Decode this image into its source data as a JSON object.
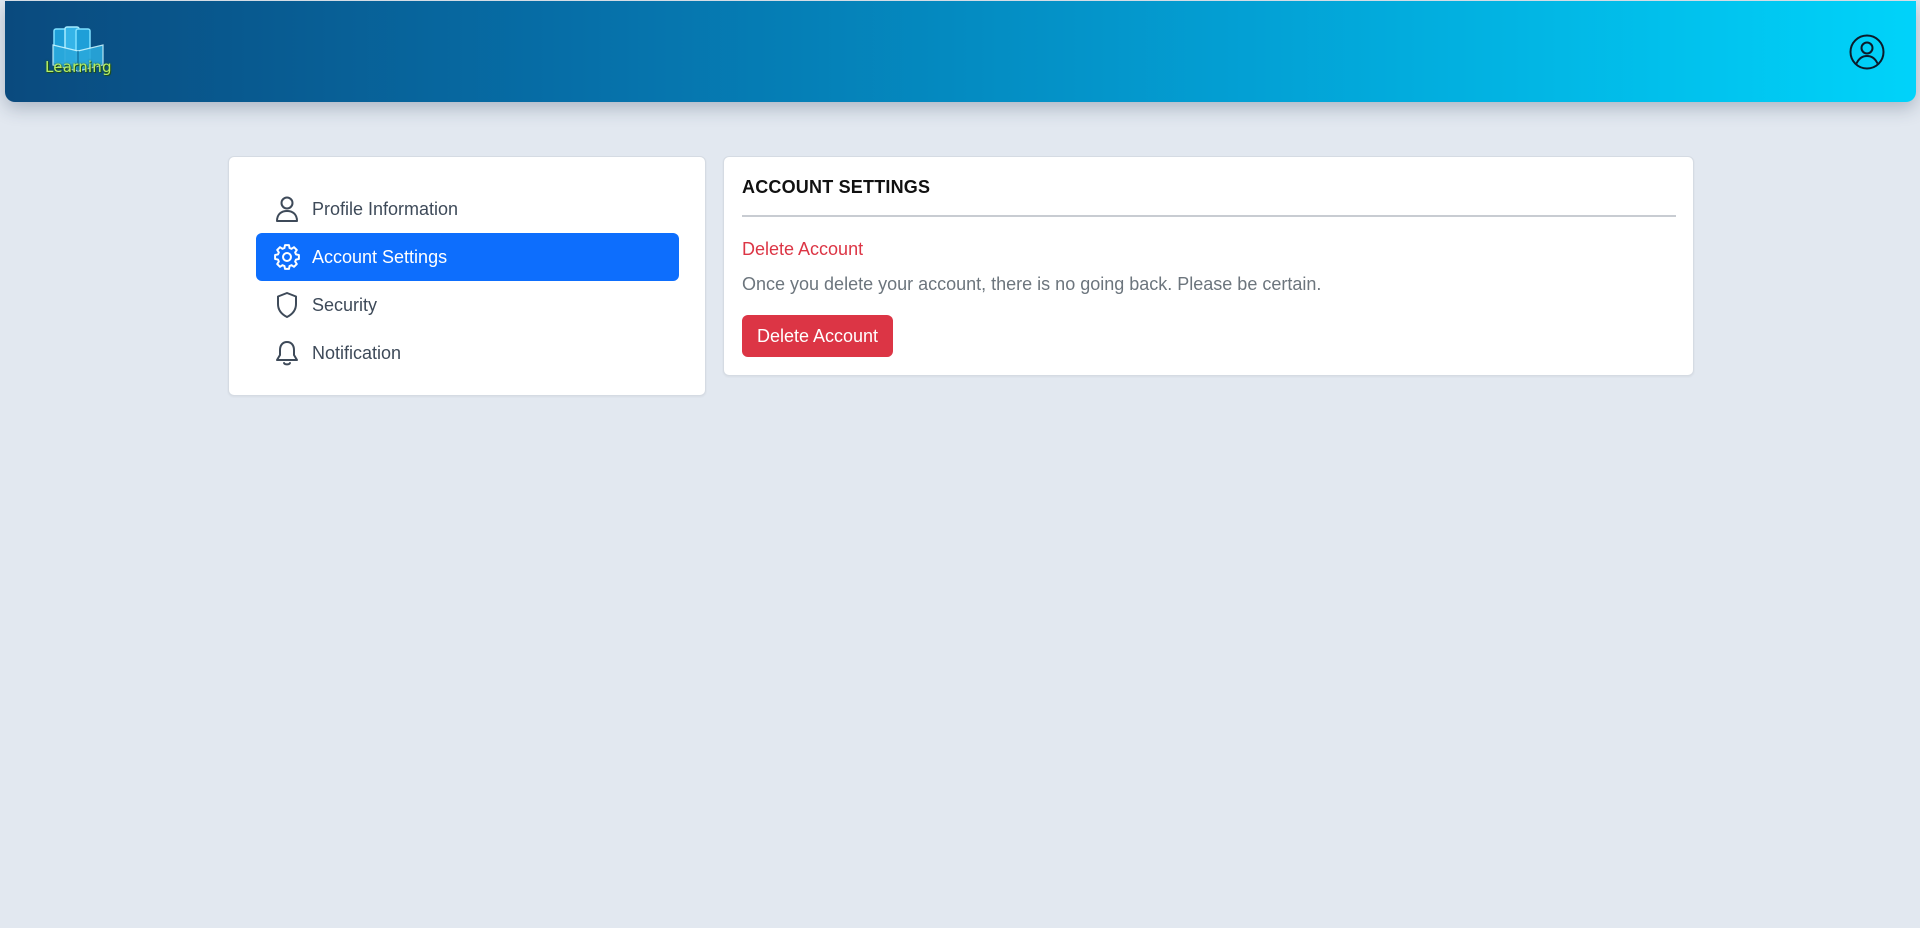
{
  "header": {
    "logo": {
      "text": "Learning",
      "icon": "book-logo-icon"
    },
    "user_icon": "user-circle-icon"
  },
  "sidebar": {
    "items": [
      {
        "label": "Profile Information",
        "icon": "user-icon",
        "active": false
      },
      {
        "label": "Account Settings",
        "icon": "gear-icon",
        "active": true
      },
      {
        "label": "Security",
        "icon": "shield-icon",
        "active": false
      },
      {
        "label": "Notification",
        "icon": "bell-icon",
        "active": false
      }
    ]
  },
  "main": {
    "title": "ACCOUNT SETTINGS",
    "delete_heading": "Delete Account",
    "delete_description": "Once you delete your account, there is no going back. Please be certain.",
    "delete_button_label": "Delete Account"
  },
  "colors": {
    "primary": "#0d6efd",
    "danger": "#dc3545",
    "muted_text": "#6c757d",
    "background": "#e2e8f0",
    "header_gradient_start": "#0a4a7e",
    "header_gradient_end": "#00d3fa"
  }
}
